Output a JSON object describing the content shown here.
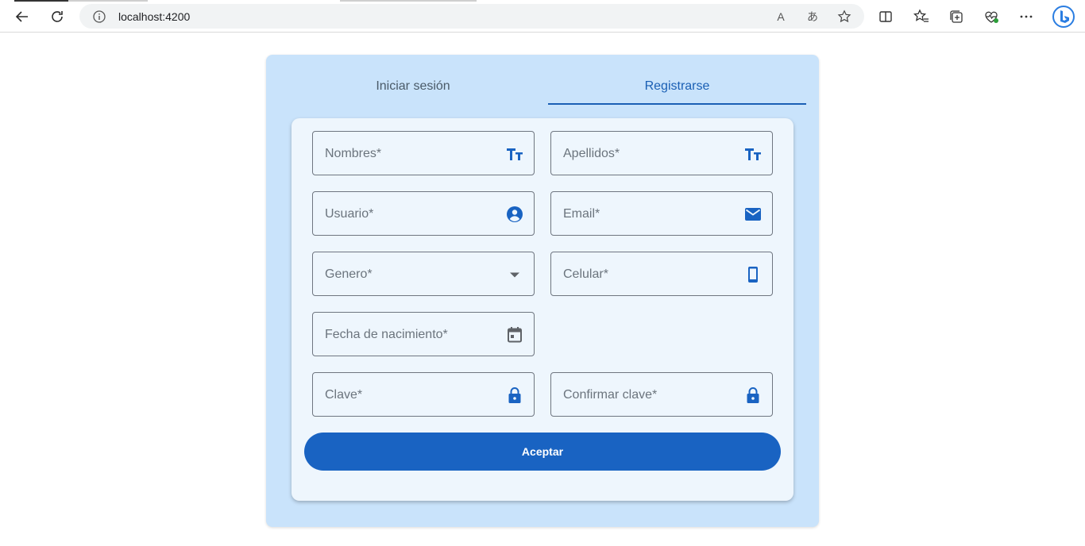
{
  "browser": {
    "url": "localhost:4200",
    "read_aloud_label": "A",
    "translate_label": "あ"
  },
  "tabs": {
    "login_label": "Iniciar sesión",
    "register_label": "Registrarse",
    "active": "register"
  },
  "form": {
    "fields": [
      {
        "label": "Nombres*",
        "icon": "text-fields-icon"
      },
      {
        "label": "Apellidos*",
        "icon": "text-fields-icon"
      },
      {
        "label": "Usuario*",
        "icon": "account-circle-icon"
      },
      {
        "label": "Email*",
        "icon": "mail-icon"
      },
      {
        "label": "Genero*",
        "icon": "dropdown-arrow-icon"
      },
      {
        "label": "Celular*",
        "icon": "smartphone-icon"
      },
      {
        "label": "Fecha de nacimiento*",
        "icon": "calendar-icon"
      },
      {
        "label": "Clave*",
        "icon": "lock-icon"
      },
      {
        "label": "Confirmar clave*",
        "icon": "lock-icon"
      }
    ],
    "submit_label": "Aceptar"
  },
  "colors": {
    "accent": "#1963c2",
    "outer_card": "#c9e3fb",
    "inner_card": "#eef6fd"
  }
}
